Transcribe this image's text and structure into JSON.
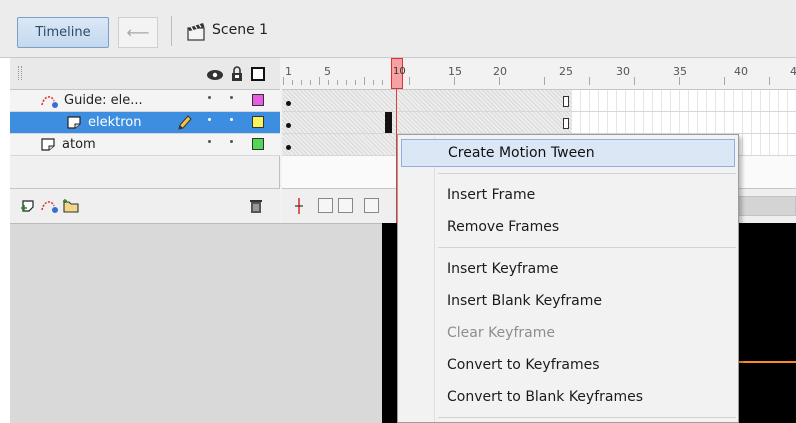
{
  "topbar": {
    "timeline_label": "Timeline",
    "back_icon": "back-arrow-icon",
    "scene_icon": "clapperboard-icon",
    "scene_label": "Scene 1"
  },
  "layer_header": {
    "icons": [
      "eye-icon",
      "lock-icon",
      "outline-icon"
    ]
  },
  "layers": [
    {
      "name": "Guide: ele...",
      "icon": "guide-layer-icon",
      "color": "#e85be3"
    },
    {
      "name": "elektron",
      "icon": "layer-icon",
      "color": "#f7f45d",
      "selected": true,
      "pencil": "pencil-icon"
    },
    {
      "name": "atom",
      "icon": "layer-icon",
      "color": "#52d653"
    }
  ],
  "ruler": {
    "labels": [
      "1",
      "5",
      "10",
      "15",
      "20",
      "25",
      "30",
      "35",
      "40",
      "4"
    ],
    "current_frame": 10
  },
  "layer_footer_icons": [
    "new-layer-icon",
    "add-guide-icon",
    "new-folder-icon",
    "trash-icon"
  ],
  "frames_footer_icons": [
    "center-frame-icon",
    "onion-skin-icon",
    "onion-outline-icon",
    "edit-multiple-icon"
  ],
  "context_menu": {
    "items": [
      {
        "label": "Create Motion Tween",
        "highlighted": true
      },
      {
        "separator": true
      },
      {
        "label": "Insert Frame"
      },
      {
        "label": "Remove Frames"
      },
      {
        "separator": true
      },
      {
        "label": "Insert Keyframe"
      },
      {
        "label": "Insert Blank Keyframe"
      },
      {
        "label": "Clear Keyframe",
        "disabled": true
      },
      {
        "label": "Convert to Keyframes"
      },
      {
        "label": "Convert to Blank Keyframes"
      },
      {
        "separator": true
      }
    ]
  },
  "colors": {
    "accent": "#3d8ee0",
    "playhead": "#e23b3b",
    "stage": "#000000",
    "orbit": "#ff8a1f"
  }
}
